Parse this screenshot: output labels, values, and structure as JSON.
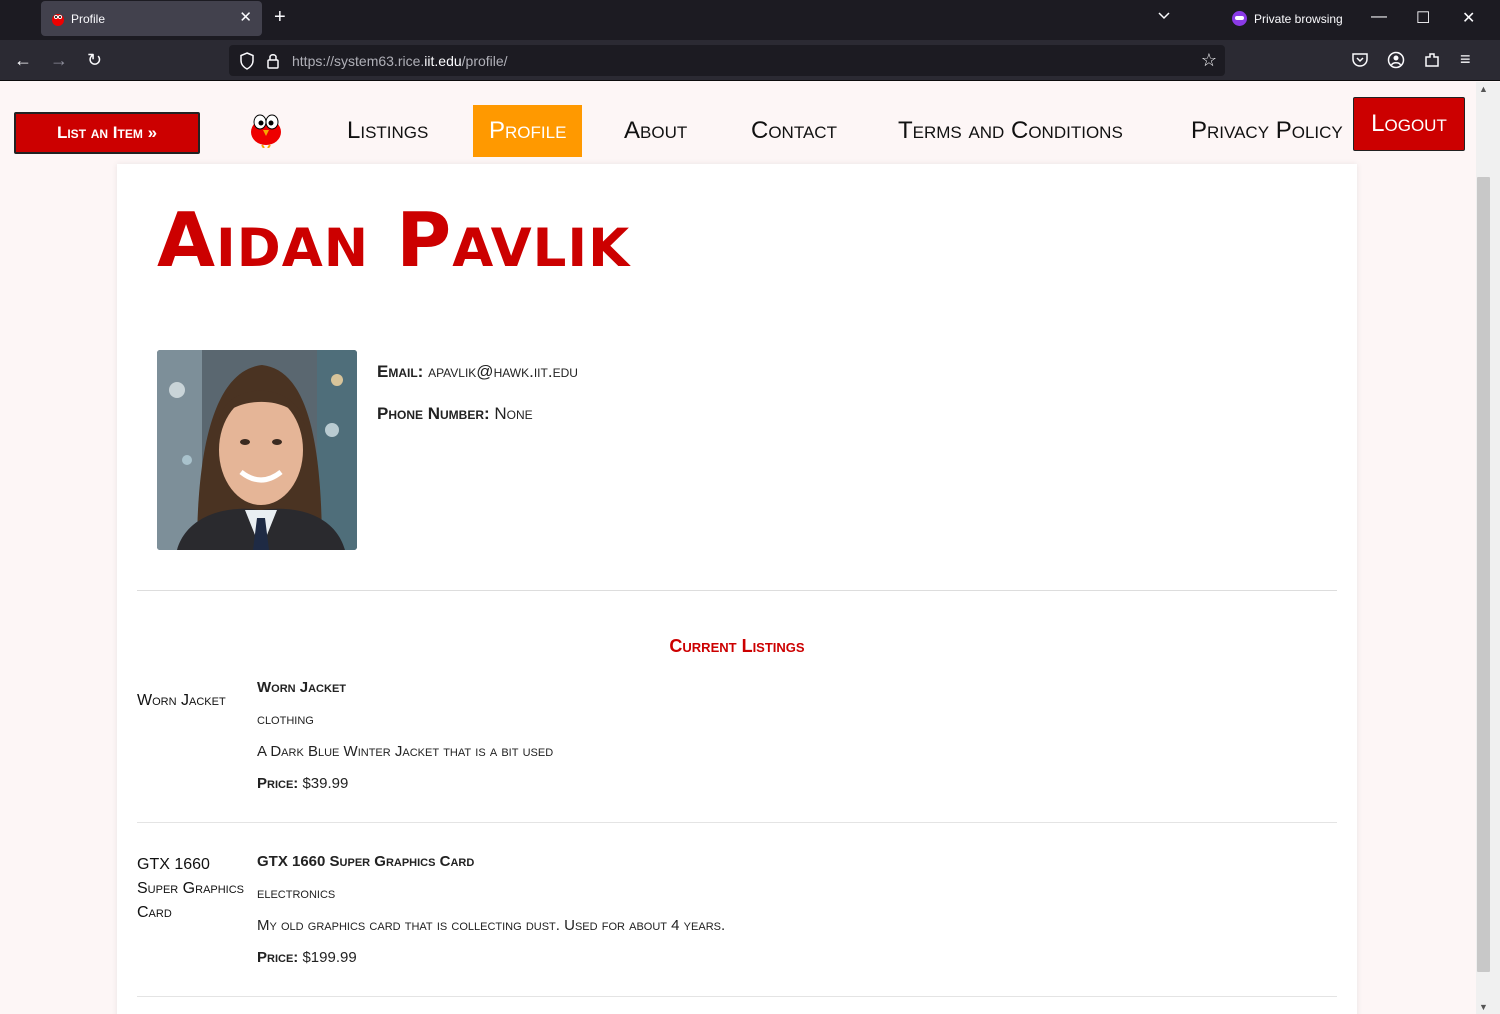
{
  "browser": {
    "tab_title": "Profile",
    "private_label": "Private browsing",
    "url_prefix": "https://system63.rice.",
    "url_domain": "iit.edu",
    "url_suffix": "/profile/"
  },
  "nav": {
    "list_item_label": "List an Item  »",
    "items": [
      "Listings",
      "Profile",
      "About",
      "Contact",
      "Terms and Conditions",
      "Privacy Policy"
    ],
    "active": "Profile",
    "logout_label": "Logout"
  },
  "profile": {
    "name": "Aidan Pavlik",
    "email_label": "Email:",
    "email": "apavlik@hawk.iit.edu",
    "phone_label": "Phone Number:",
    "phone": "None"
  },
  "listings_title": "Current Listings",
  "listings": [
    {
      "thumb_alt": "Worn Jacket",
      "title": "Worn Jacket",
      "category": "clothing",
      "description": "A Dark Blue Winter Jacket that is a bit used",
      "price_label": "Price:",
      "price": "$39.99"
    },
    {
      "thumb_alt": "GTX 1660 Super Graphics Card",
      "title": "GTX 1660 Super Graphics Card",
      "category": "electronics",
      "description": "My old graphics card that is collecting dust. Used for about 4 years.",
      "price_label": "Price:",
      "price": "$199.99"
    }
  ],
  "colors": {
    "brand_red": "#cc0000",
    "active_orange": "#ff9900"
  }
}
